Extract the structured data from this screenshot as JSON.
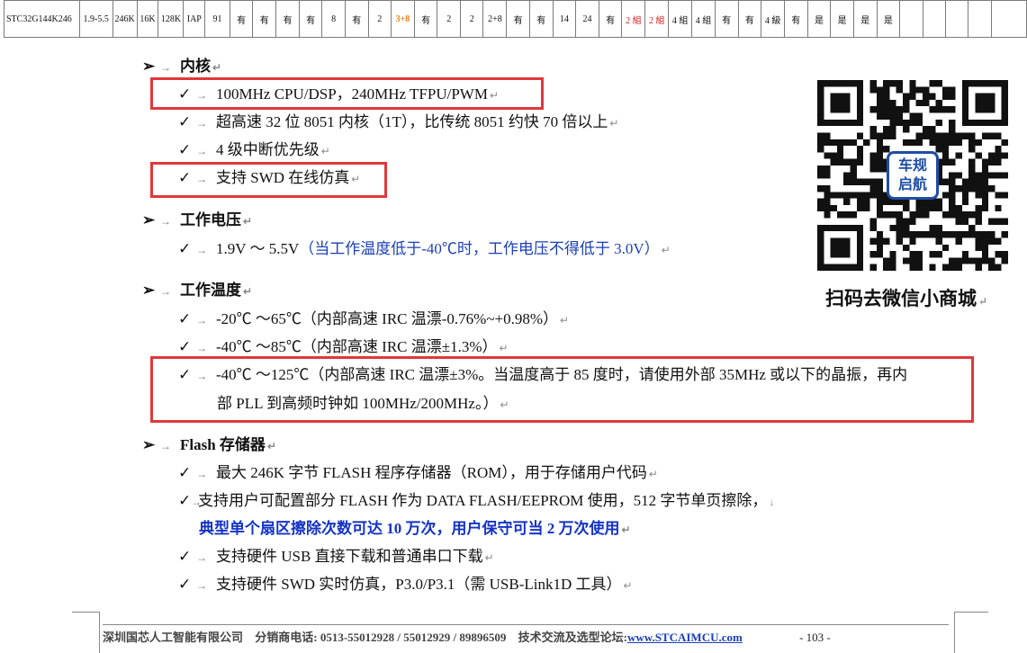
{
  "table": {
    "cells": [
      "STC32G144K246",
      "1.9-5.5",
      "246K",
      "16K",
      "128K",
      "IAP",
      "91",
      "有",
      "有",
      "有",
      "有",
      "8",
      "有",
      "2",
      "3+8",
      "有",
      "2",
      "2",
      "2+8",
      "有",
      "有",
      "14",
      "24",
      "有",
      "2 組",
      "2 組",
      "4 組",
      "4 組",
      "有",
      "有",
      "4 級",
      "有",
      "是",
      "是",
      "是",
      "是",
      "",
      "",
      "",
      "",
      ""
    ],
    "red_cells": [
      24,
      25
    ],
    "orange_cells": [
      14
    ]
  },
  "sections": {
    "core": {
      "title": "内核",
      "items": [
        "100MHz CPU/DSP，240MHz TFPU/PWM",
        "超高速 32 位 8051 内核（1T），比传统 8051 约快 70 倍以上",
        "4 级中断优先级",
        "支持 SWD 在线仿真"
      ]
    },
    "voltage": {
      "title": "工作电压",
      "item_main": "1.9V ～ 5.5V",
      "item_note": "（当工作温度低于-40℃时，工作电压不得低于 3.0V）"
    },
    "temperature": {
      "title": "工作温度",
      "items": [
        "-20℃ ～65℃（内部高速 IRC 温漂-0.76%~+0.98%）",
        "-40℃ ～85℃（内部高速 IRC 温漂±1.3%）"
      ],
      "item3_line1": "-40℃ ～125℃（内部高速 IRC 温漂±3%。当温度高于 85 度时，请使用外部 35MHz 或以下的晶振，再内",
      "item3_line2": "部 PLL 到高频时钟如 100MHz/200MHz。）"
    },
    "flash": {
      "title": "Flash 存储器",
      "item1": "最大 246K 字节 FLASH 程序存储器（ROM），用于存储用户代码",
      "item2": "支持用户可配置部分 FLASH 作为 DATA FLASH/EEPROM 使用，512 字节单页擦除，",
      "item2_emphasis": "典型单个扇区擦除次数可达 10 万次，用户保守可当 2 万次使用",
      "item3": "支持硬件 USB 直接下载和普通串口下载",
      "item4": "支持硬件 SWD 实时仿真，P3.0/P3.1（需 USB-Link1D 工具）"
    }
  },
  "symbols": {
    "section_marker": "➢",
    "check_marker": "✓",
    "tab_arrow": "→",
    "paragraph_mark": "↵"
  },
  "qr": {
    "badge_line1": "车规",
    "badge_line2": "启航",
    "caption": "扫码去微信小商城",
    "badge_color": "#1e4da6"
  },
  "footer": {
    "company": "深圳国芯人工智能有限公司",
    "phone": "分销商电话: 0513-55012928 / 55012929 / 89896509",
    "forum_label": "技术交流及选型论坛:",
    "forum_url": "www.STCAIMCU.com",
    "page": "- 103 -"
  },
  "colors": {
    "highlight_box": "#e0383b",
    "blue_text": "#1b3fb6",
    "red_cell": "#d41c1c",
    "orange_cell": "#e7821d"
  }
}
